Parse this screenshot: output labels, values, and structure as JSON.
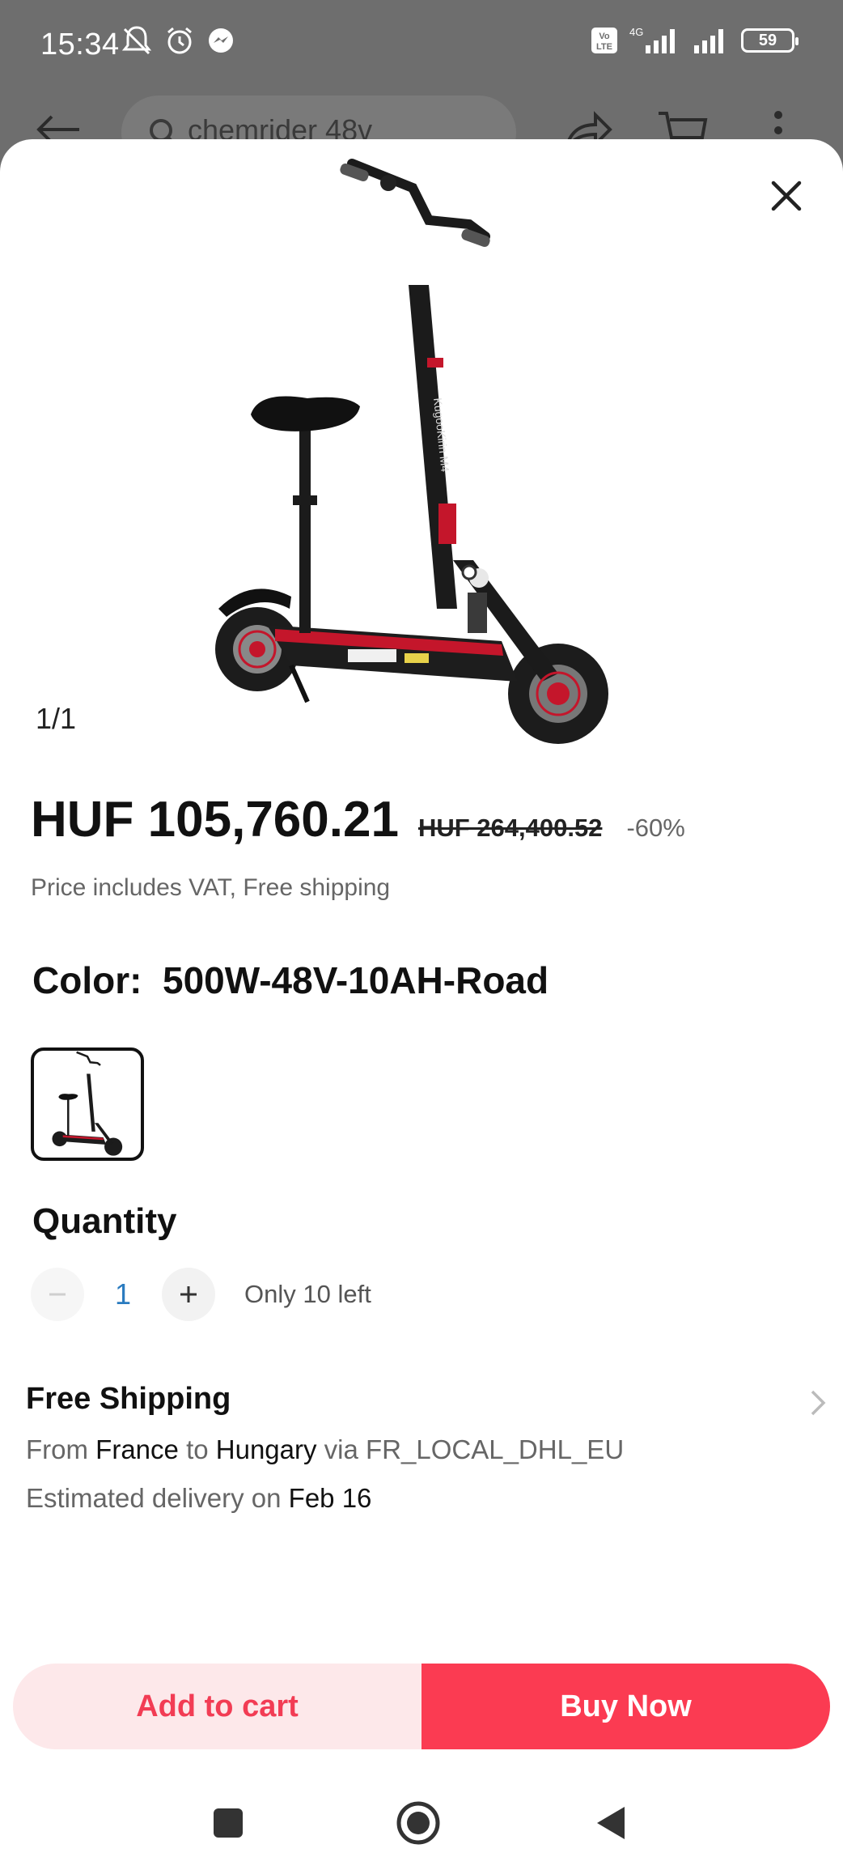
{
  "status_bar": {
    "time": "15:34",
    "network": "4G",
    "volte": "Vo LTE",
    "battery": "59"
  },
  "background": {
    "search_text": "chemrider 48v"
  },
  "product": {
    "image_counter": "1/1",
    "image_name": "electric-scooter-with-seat",
    "image_text": "KugooKirin M4",
    "price_current": "HUF 105,760.21",
    "price_original": "HUF 264,400.52",
    "discount": "-60%",
    "price_note": "Price includes VAT, Free shipping",
    "color_label": "Color:",
    "color_value": "500W-48V-10AH-Road"
  },
  "quantity": {
    "title": "Quantity",
    "value": "1",
    "stock": "Only 10 left"
  },
  "shipping": {
    "title": "Free Shipping",
    "from_prefix": "From",
    "from_country": "France",
    "to_word": "to",
    "to_country": "Hungary",
    "via_text": "via FR_LOCAL_DHL_EU",
    "delivery_prefix": "Estimated delivery on",
    "delivery_date": "Feb 16"
  },
  "actions": {
    "add_to_cart": "Add to cart",
    "buy_now": "Buy Now"
  },
  "colors": {
    "accent": "#fb3b52",
    "accent_light": "#fde8ea",
    "qty_blue": "#2a7bbf"
  }
}
